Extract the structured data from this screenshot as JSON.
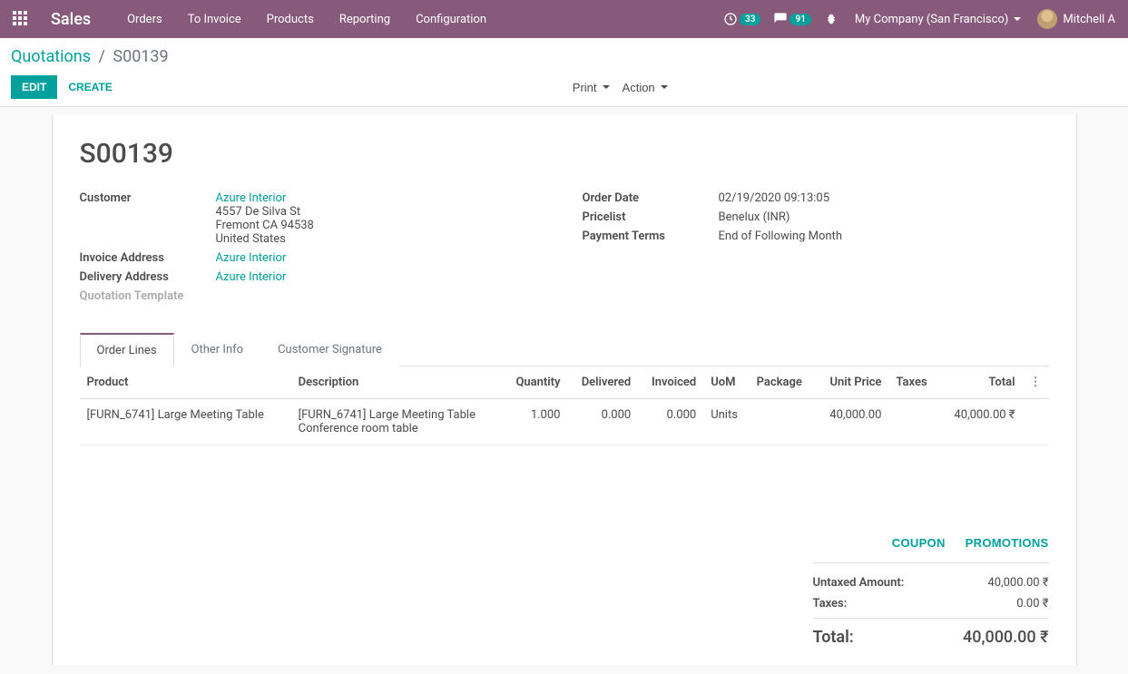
{
  "nav": {
    "brand": "Sales",
    "links": [
      "Orders",
      "To Invoice",
      "Products",
      "Reporting",
      "Configuration"
    ],
    "clock_badge": "33",
    "chat_badge": "91",
    "company": "My Company (San Francisco)",
    "user": "Mitchell A"
  },
  "breadcrumb": {
    "root": "Quotations",
    "sep": "/",
    "current": "S00139"
  },
  "buttons": {
    "edit": "EDIT",
    "create": "CREATE",
    "print": "Print",
    "action": "Action"
  },
  "record": {
    "title": "S00139",
    "left": {
      "customer_label": "Customer",
      "customer_link": "Azure Interior",
      "addr1": "4557 De Silva St",
      "addr2": "Fremont CA 94538",
      "addr3": "United States",
      "invoice_addr_label": "Invoice Address",
      "invoice_addr_link": "Azure Interior",
      "delivery_addr_label": "Delivery Address",
      "delivery_addr_link": "Azure Interior",
      "template_label": "Quotation Template"
    },
    "right": {
      "order_date_label": "Order Date",
      "order_date": "02/19/2020 09:13:05",
      "pricelist_label": "Pricelist",
      "pricelist": "Benelux (INR)",
      "terms_label": "Payment Terms",
      "terms": "End of Following Month"
    }
  },
  "tabs": [
    "Order Lines",
    "Other Info",
    "Customer Signature"
  ],
  "table": {
    "headers": {
      "product": "Product",
      "description": "Description",
      "quantity": "Quantity",
      "delivered": "Delivered",
      "invoiced": "Invoiced",
      "uom": "UoM",
      "package": "Package",
      "unit_price": "Unit Price",
      "taxes": "Taxes",
      "total": "Total"
    },
    "rows": [
      {
        "product": "[FURN_6741] Large Meeting Table",
        "desc1": "[FURN_6741] Large Meeting Table",
        "desc2": "Conference room table",
        "quantity": "1.000",
        "delivered": "0.000",
        "invoiced": "0.000",
        "uom": "Units",
        "package": "",
        "unit_price": "40,000.00",
        "taxes": "",
        "total": "40,000.00 ₹"
      }
    ]
  },
  "line_actions": {
    "coupon": "COUPON",
    "promotions": "PROMOTIONS"
  },
  "totals": {
    "untaxed_label": "Untaxed Amount:",
    "untaxed": "40,000.00 ₹",
    "taxes_label": "Taxes:",
    "taxes": "0.00 ₹",
    "total_label": "Total:",
    "total": "40,000.00 ₹"
  }
}
